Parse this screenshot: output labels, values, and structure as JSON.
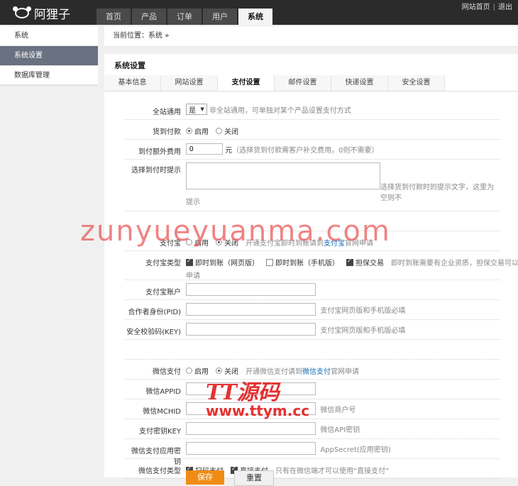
{
  "app": {
    "name": "阿狸子"
  },
  "nav": {
    "tabs": [
      "首页",
      "产品",
      "订单",
      "用户",
      "系统"
    ],
    "active_index": 4
  },
  "toplinks": {
    "home": "网站首页",
    "sep": "|",
    "logout": "退出"
  },
  "sidebar": {
    "items": [
      "系统",
      "系统设置",
      "数据库管理"
    ],
    "active_index": 1
  },
  "breadcrumb": {
    "prefix": "当前位置：",
    "current": "系统",
    "arrow": "»"
  },
  "panel": {
    "title": "系统设置"
  },
  "subtabs": {
    "items": [
      "基本信息",
      "网站设置",
      "支付设置",
      "邮件设置",
      "快递设置",
      "安全设置"
    ],
    "active_index": 2
  },
  "form": {
    "global": {
      "label": "全站通用",
      "value": "是",
      "arrow": "▼",
      "hint": "非全站通用，可单独对某个产品设置支付方式"
    },
    "cod": {
      "label": "货到付款",
      "on": "启用",
      "off": "关闭"
    },
    "cod_fee": {
      "label": "到付额外费用",
      "value": "0",
      "unit": "元",
      "hint": "（选择货到付款需客户补交费用。0则不需要）"
    },
    "cod_tip": {
      "label": "选择到付时提示",
      "hint": "选择货到付款时的提示文字，这里为空则不提示",
      "hint_line1": "选择货到付款时的提示文字，这里为空则不",
      "hint_line2": "提示"
    },
    "alipay": {
      "label": "支付宝",
      "on": "启用",
      "off": "关闭",
      "hint_pre": "开通支付宝即时到账请到",
      "hint_link": "支付宝",
      "hint_post": "官网申请"
    },
    "alipay_type": {
      "label": "支付宝类型",
      "opt1": "即时到账（网页版）",
      "opt2": "即时到账（手机版）",
      "opt3": "担保交易",
      "hint_line1": "即时到账需要有企业资质，担保交易可以个人",
      "hint_line2": "申请"
    },
    "alipay_account": {
      "label": "支付宝账户"
    },
    "pid": {
      "label": "合作者身份(PID)",
      "hint": "支付宝网页版和手机版必填"
    },
    "key": {
      "label": "安全校验码(KEY)",
      "hint": "支付宝网页版和手机版必填"
    },
    "wechat": {
      "label": "微信支付",
      "on": "启用",
      "off": "关闭",
      "hint_pre": "开通微信支付请到",
      "hint_link": "微信支付",
      "hint_post": "官网申请"
    },
    "appid": {
      "label": "微信APPID"
    },
    "mchid": {
      "label": "微信MCHID",
      "hint": "微信商户号"
    },
    "apikey": {
      "label": "支付密钥KEY",
      "hint": "微信API密钥"
    },
    "appsecret": {
      "label": "微信支付应用密钥",
      "hint": "AppSecret(应用密钥)"
    },
    "wechat_type": {
      "label": "微信支付类型",
      "opt1": "扫码支付",
      "opt2": "直接支付",
      "hint": "只有在微信端才可以使用“直接支付”"
    }
  },
  "buttons": {
    "save": "保存",
    "reset": "重置"
  },
  "watermarks": {
    "wm1": "zunyueyuanma.com",
    "wm2": "TT源码",
    "wm3": "www.ttym.cc"
  },
  "colors": {
    "topbar": "#2b2b2b",
    "accent": "#f08c14",
    "sidebar_active": "#6a7180",
    "link": "#0d6ab8"
  }
}
